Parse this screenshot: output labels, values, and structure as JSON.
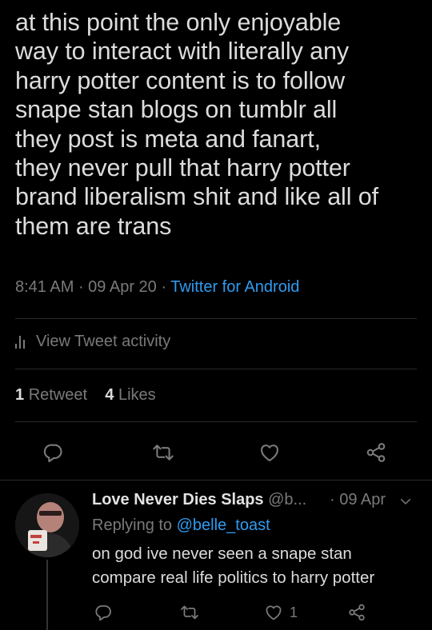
{
  "tweet": {
    "text": "at this point the only enjoyable\nway to interact with literally any\nharry potter content is to follow\nsnape stan blogs on tumblr all\nthey post is meta and fanart,\nthey never pull that harry potter\nbrand liberalism shit and like all of\nthem are trans",
    "time": "8:41 AM",
    "date": "09 Apr 20",
    "source": "Twitter for Android",
    "activity_label": "View Tweet activity",
    "retweet_count": "1",
    "retweet_label": "Retweet",
    "like_count": "4",
    "like_label": "Likes"
  },
  "reply": {
    "name": "Love Never Dies Slaps",
    "handle": "@b...",
    "date": "· 09 Apr",
    "replying_prefix": "Replying to",
    "replying_to": "@belle_toast",
    "text": "on god ive never seen a snape stan\ncompare real life politics to harry potter",
    "like_count": "1"
  },
  "colors": {
    "background": "#000000",
    "text": "#dcdcdc",
    "muted": "#7a7a7a",
    "link": "#2f9bf0",
    "divider": "#2a2a2a"
  },
  "icons": {
    "reply": "reply-icon",
    "retweet": "retweet-icon",
    "like": "heart-icon",
    "share": "share-icon",
    "activity": "bar-chart-icon",
    "menu": "chevron-down-icon"
  }
}
